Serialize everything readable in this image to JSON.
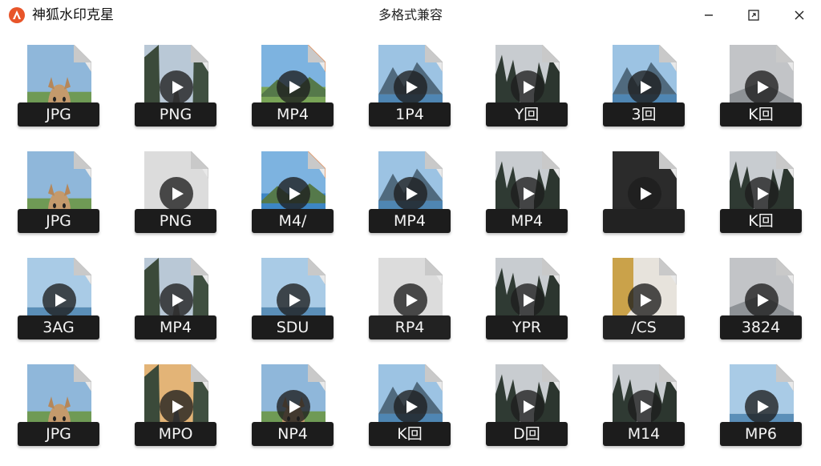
{
  "app": {
    "name": "神狐水印克星",
    "window_title": "多格式兼容",
    "accent": "#e8552a"
  },
  "window_controls": {
    "minimize_icon": "minimize-icon",
    "maximize_icon": "maximize-icon",
    "close_icon": "close-icon"
  },
  "files": [
    {
      "label": "JPG",
      "thumb": "dog-road",
      "play": false
    },
    {
      "label": "PNG",
      "thumb": "forest-road",
      "play": true
    },
    {
      "label": "MP4",
      "thumb": "orange-landscape",
      "play": true,
      "orange": true
    },
    {
      "label": "1P4",
      "thumb": "lake-mountain",
      "play": true
    },
    {
      "label": "Y回",
      "thumb": "pine-forest",
      "play": true
    },
    {
      "label": "3回",
      "thumb": "lake-mountain",
      "play": true
    },
    {
      "label": "K回",
      "thumb": "grey",
      "play": true
    },
    {
      "label": "JPG",
      "thumb": "dog-lake",
      "play": false
    },
    {
      "label": "PNG",
      "thumb": "blank",
      "play": true
    },
    {
      "label": "M4/",
      "thumb": "orange-lake",
      "play": true,
      "orange": true
    },
    {
      "label": "MP4",
      "thumb": "lake-mountain",
      "play": true
    },
    {
      "label": "MP4",
      "thumb": "pine-forest",
      "play": true
    },
    {
      "label": "",
      "thumb": "dark",
      "play": true,
      "big": true
    },
    {
      "label": "K回",
      "thumb": "pine-forest",
      "play": true
    },
    {
      "label": "3AG",
      "thumb": "sea",
      "play": true
    },
    {
      "label": "MP4",
      "thumb": "forest-road",
      "play": true
    },
    {
      "label": "SDU",
      "thumb": "sea",
      "play": true
    },
    {
      "label": "RP4",
      "thumb": "blank",
      "play": true,
      "big": true
    },
    {
      "label": "YPR",
      "thumb": "pine-forest",
      "play": true
    },
    {
      "label": "/CS",
      "thumb": "gold",
      "play": true,
      "big": true
    },
    {
      "label": "3824",
      "thumb": "grey",
      "play": true
    },
    {
      "label": "JPG",
      "thumb": "dog-road",
      "play": false
    },
    {
      "label": "MPO",
      "thumb": "sunset-road",
      "play": true
    },
    {
      "label": "NP4",
      "thumb": "dog-lake",
      "play": true
    },
    {
      "label": "K回",
      "thumb": "lake-mountain",
      "play": true
    },
    {
      "label": "D回",
      "thumb": "pine-forest",
      "play": true
    },
    {
      "label": "M14",
      "thumb": "pine-forest",
      "play": true
    },
    {
      "label": "MP6",
      "thumb": "sea",
      "play": true
    }
  ]
}
